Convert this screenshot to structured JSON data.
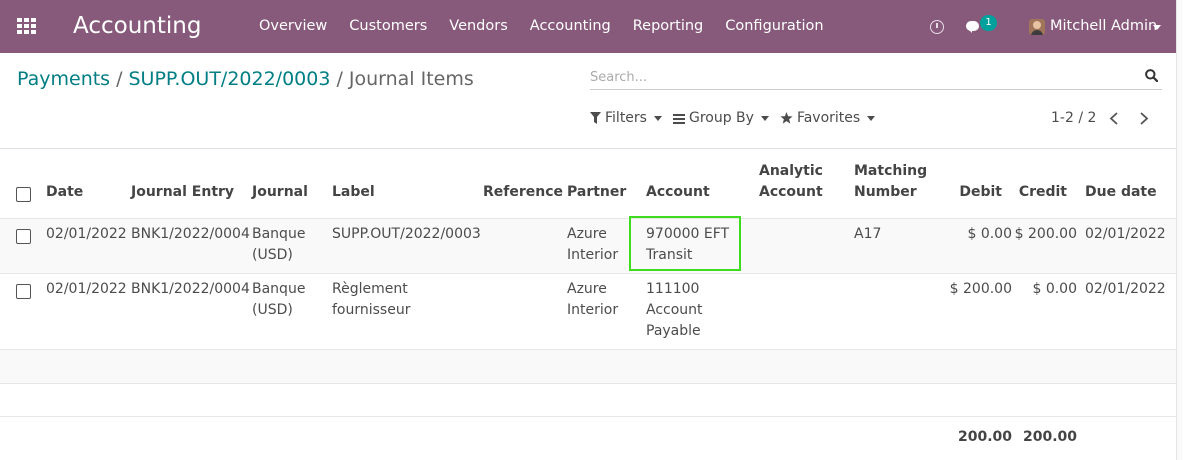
{
  "navbar": {
    "brand": "Accounting",
    "menu": [
      "Overview",
      "Customers",
      "Vendors",
      "Accounting",
      "Reporting",
      "Configuration"
    ],
    "chat_badge": "1",
    "user": "Mitchell Admin",
    "bg_color": "#875a7b"
  },
  "breadcrumb": {
    "items": [
      "Payments",
      "SUPP.OUT/2022/0003"
    ],
    "separator": "/",
    "current": "Journal Items"
  },
  "search": {
    "placeholder": "Search..."
  },
  "filters": {
    "filters_label": "Filters",
    "group_by_label": "Group By",
    "favorites_label": "Favorites"
  },
  "pager": {
    "text": "1-2 / 2"
  },
  "table": {
    "columns": {
      "date": "Date",
      "journal_entry": "Journal Entry",
      "journal": "Journal",
      "label": "Label",
      "reference": "Reference",
      "partner": "Partner",
      "account": "Account",
      "analytic_line1": "Analytic",
      "analytic_line2": "Account",
      "matching_line1": "Matching",
      "matching_line2": "Number",
      "debit": "Debit",
      "credit": "Credit",
      "due_date": "Due date"
    },
    "rows": [
      {
        "date": "02/01/2022",
        "journal_entry": "BNK1/2022/0004",
        "journal_line1": "Banque",
        "journal_line2": "(USD)",
        "label_line1": "SUPP.OUT/2022/0003",
        "label_line2": "",
        "reference": "",
        "partner_line1": "Azure",
        "partner_line2": "Interior",
        "account_line1": "970000 EFT",
        "account_line2": "Transit",
        "account_line3": "",
        "analytic": "",
        "matching": "A17",
        "debit": "$ 0.00",
        "credit": "$ 200.00",
        "due_date": "02/01/2022"
      },
      {
        "date": "02/01/2022",
        "journal_entry": "BNK1/2022/0004",
        "journal_line1": "Banque",
        "journal_line2": "(USD)",
        "label_line1": "Règlement",
        "label_line2": "fournisseur",
        "reference": "",
        "partner_line1": "Azure",
        "partner_line2": "Interior",
        "account_line1": "111100",
        "account_line2": "Account",
        "account_line3": "Payable",
        "analytic": "",
        "matching": "",
        "debit": "$ 200.00",
        "credit": "$ 0.00",
        "due_date": "02/01/2022"
      }
    ],
    "totals": {
      "debit": "200.00",
      "credit": "200.00"
    }
  },
  "colors": {
    "link": "#017e84",
    "highlight_border": "#3ddc1e",
    "badge": "#00a09d"
  }
}
